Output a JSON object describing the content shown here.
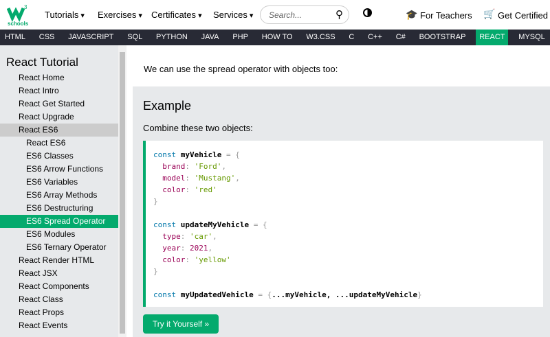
{
  "header": {
    "logo_text": "schools",
    "logo_sup": "3",
    "menus": [
      "Tutorials",
      "Exercises",
      "Certificates",
      "Services"
    ],
    "search_placeholder": "Search...",
    "for_teachers": "For Teachers",
    "get_certified": "Get Certified"
  },
  "nav": [
    "HTML",
    "CSS",
    "JAVASCRIPT",
    "SQL",
    "PYTHON",
    "JAVA",
    "PHP",
    "HOW TO",
    "W3.CSS",
    "C",
    "C++",
    "C#",
    "BOOTSTRAP",
    "REACT",
    "MYSQL"
  ],
  "sidebar": {
    "title": "React Tutorial",
    "items": [
      {
        "label": "React Home"
      },
      {
        "label": "React Intro"
      },
      {
        "label": "React Get Started"
      },
      {
        "label": "React Upgrade"
      },
      {
        "label": "React ES6",
        "state": "sel"
      },
      {
        "label": "React ES6",
        "sub": true
      },
      {
        "label": "ES6 Classes",
        "sub": true
      },
      {
        "label": "ES6 Arrow Functions",
        "sub": true
      },
      {
        "label": "ES6 Variables",
        "sub": true
      },
      {
        "label": "ES6 Array Methods",
        "sub": true
      },
      {
        "label": "ES6 Destructuring",
        "sub": true
      },
      {
        "label": "ES6 Spread Operator",
        "sub": true,
        "state": "on"
      },
      {
        "label": "ES6 Modules",
        "sub": true
      },
      {
        "label": "ES6 Ternary Operator",
        "sub": true
      },
      {
        "label": "React Render HTML"
      },
      {
        "label": "React JSX"
      },
      {
        "label": "React Components"
      },
      {
        "label": "React Class"
      },
      {
        "label": "React Props"
      },
      {
        "label": "React Events"
      }
    ]
  },
  "main": {
    "intro": "We can use the spread operator with objects too:",
    "example_title": "Example",
    "example_desc": "Combine these two objects:",
    "try_button": "Try it Yourself »",
    "code": {
      "v1": "myVehicle",
      "brand": "'Ford'",
      "model": "'Mustang'",
      "color1": "'red'",
      "v2": "updateMyVehicle",
      "type": "'car'",
      "year": "2021",
      "color2": "'yellow'",
      "v3": "myUpdatedVehicle",
      "spread": "...myVehicle, ...updateMyVehicle"
    }
  },
  "colors": {
    "accent": "#04AA6D",
    "nav": "#282A35",
    "purple": "#9763f6"
  }
}
